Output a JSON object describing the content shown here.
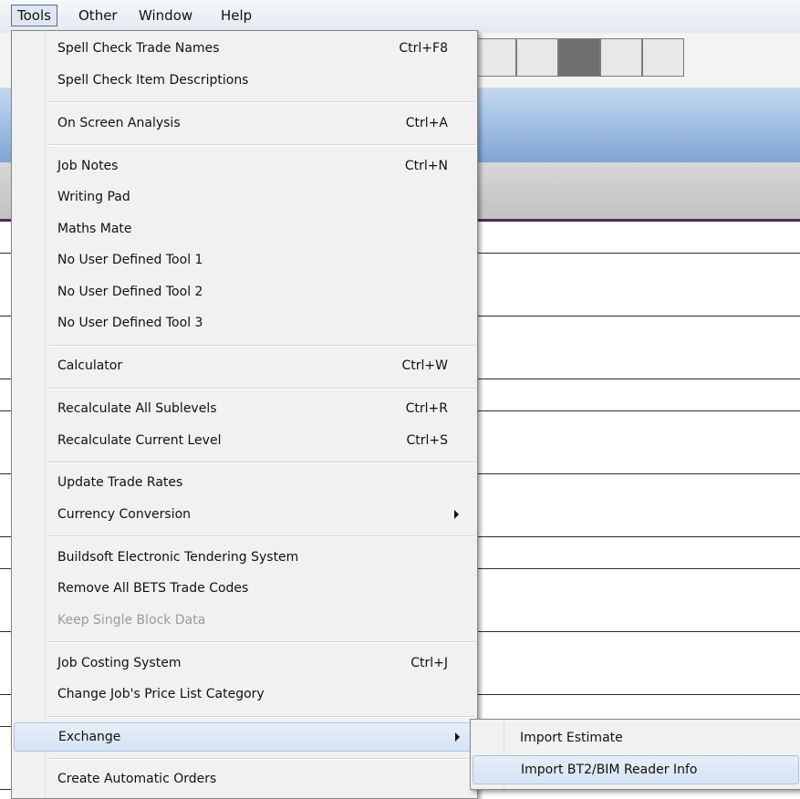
{
  "menubar": {
    "items": [
      {
        "label": "Tools"
      },
      {
        "label": "Other"
      },
      {
        "label": "Window"
      },
      {
        "label": "Help"
      }
    ]
  },
  "tools_menu": {
    "items": [
      {
        "label": "Spell Check Trade Names",
        "shortcut": "Ctrl+F8"
      },
      {
        "label": "Spell Check Item Descriptions",
        "shortcut": ""
      },
      {
        "label": "On Screen Analysis",
        "shortcut": "Ctrl+A"
      },
      {
        "label": "Job Notes",
        "shortcut": "Ctrl+N"
      },
      {
        "label": "Writing Pad",
        "shortcut": ""
      },
      {
        "label": "Maths Mate",
        "shortcut": ""
      },
      {
        "label": "No User Defined Tool 1",
        "shortcut": ""
      },
      {
        "label": "No User Defined Tool 2",
        "shortcut": ""
      },
      {
        "label": "No User Defined Tool 3",
        "shortcut": ""
      },
      {
        "label": "Calculator",
        "shortcut": "Ctrl+W"
      },
      {
        "label": "Recalculate All Sublevels",
        "shortcut": "Ctrl+R"
      },
      {
        "label": "Recalculate Current Level",
        "shortcut": "Ctrl+S"
      },
      {
        "label": "Update Trade Rates",
        "shortcut": ""
      },
      {
        "label": "Currency Conversion",
        "shortcut": "",
        "submenu": true
      },
      {
        "label": "Buildsoft Electronic Tendering System",
        "shortcut": ""
      },
      {
        "label": "Remove All BETS Trade Codes",
        "shortcut": ""
      },
      {
        "label": "Keep Single Block Data",
        "shortcut": "",
        "disabled": true
      },
      {
        "label": "Job Costing System",
        "shortcut": "Ctrl+J"
      },
      {
        "label": "Change Job's Price List Category",
        "shortcut": ""
      },
      {
        "label": "Exchange",
        "shortcut": "",
        "submenu": true,
        "highlighted": true
      },
      {
        "label": "Create Automatic Orders",
        "shortcut": ""
      }
    ]
  },
  "exchange_submenu": {
    "items": [
      {
        "label": "Import Estimate"
      },
      {
        "label": "Import BT2/BIM Reader Info",
        "highlighted": true
      }
    ]
  }
}
